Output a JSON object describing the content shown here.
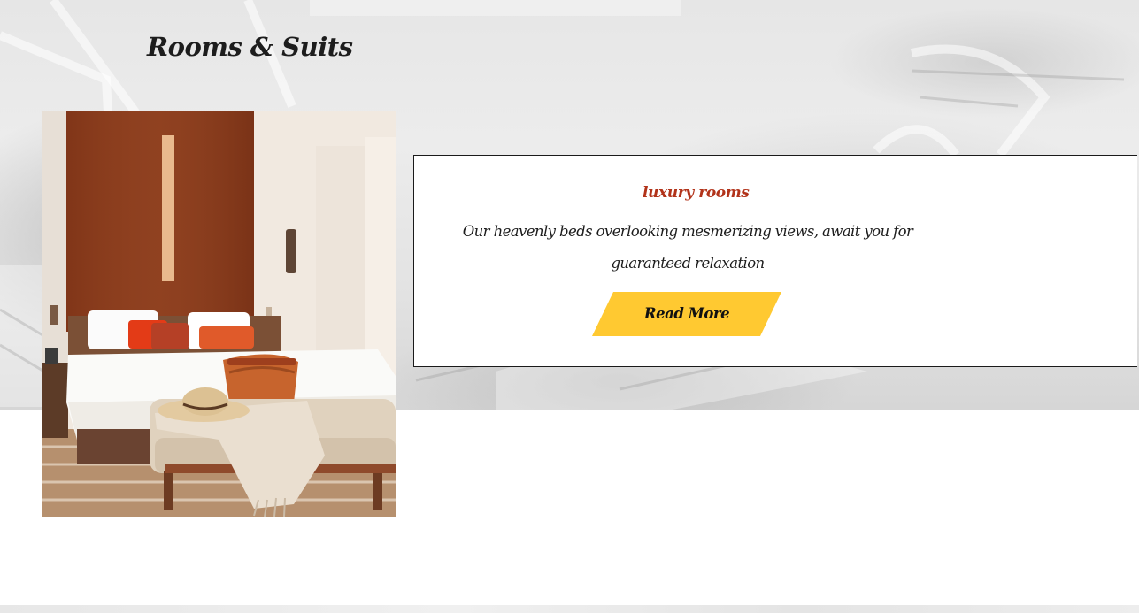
{
  "section": {
    "title": "Rooms & Suits"
  },
  "room_card": {
    "image_alt": "Hotel bedroom with a large bed, orange pillows, a straw hat and a woven basket on a bench",
    "tag": "luxury rooms",
    "description": "Our heavenly beds overlooking mesmerizing views, await you for guaranteed relaxation",
    "button_label": "Read More"
  },
  "colors": {
    "accent_button": "#ffc931",
    "tag_text": "#b2331a",
    "heading_text": "#1d1d1d",
    "card_border": "#1a1a1a"
  }
}
